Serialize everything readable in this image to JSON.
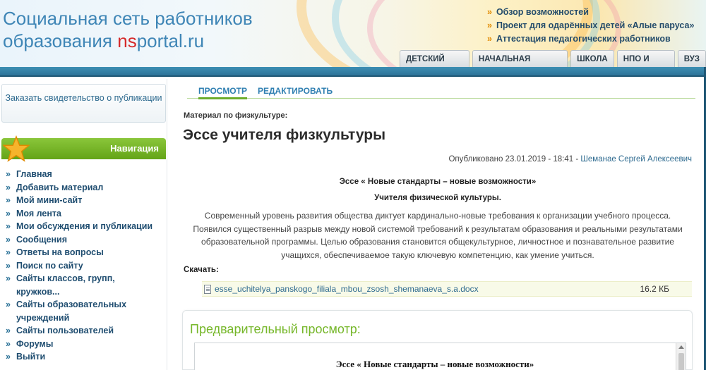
{
  "header": {
    "logo_line1": "Социальная сеть работников",
    "logo_line2_prefix": "образования ",
    "logo_brand_ns": "ns",
    "logo_brand_rest": "portal.ru",
    "top_links": [
      "Обзор возможностей",
      "Проект для одарённых детей «Алые паруса»",
      "Аттестация педагогических работников"
    ],
    "tabs": [
      "ДЕТСКИЙ САД",
      "НАЧАЛЬНАЯ ШКОЛА",
      "ШКОЛА",
      "НПО И СПО",
      "ВУЗ"
    ]
  },
  "sidebar": {
    "cert_button": "Заказать свидетельство о публикации",
    "nav_title": "Навигация",
    "nav_items": [
      "Главная",
      "Добавить материал",
      "Мой мини-сайт",
      "Моя лента",
      "Мои обсуждения и публикации",
      "Сообщения",
      "Ответы на вопросы",
      "Поиск по сайту",
      "Сайты классов, групп, кружков...",
      "Сайты образовательных учреждений",
      "Сайты пользователей",
      "Форумы",
      "Выйти"
    ]
  },
  "main": {
    "view_tab": "ПРОСМОТР",
    "edit_tab": "РЕДАКТИРОВАТЬ",
    "rubric": "Материал по физкультуре:",
    "title": "Эссе учителя физкультуры",
    "published_prefix": "Опубликовано 23.01.2019 - 18:41 - ",
    "author": "Шеманае Сергей Алексеевич",
    "essay_heading": "Эссе « Новые стандарты – новые возможности»",
    "essay_subheading": "Учителя физической культуры.",
    "essay_text": "Современный уровень развития общества диктует кардинально-новые требования к организации учебного процесса. Появился существенный разрыв между новой системой требований к результатам образования и реальными результатами образовательной программы.  Целью образования становится общекультурное, личностное и познавательное развитие учащихся, обеспечиваемое такую ключевую компетенцию, как умение учиться.",
    "download_label": "Скачать:",
    "file_name": "esse_uchitelya_panskogo_filiala_mbou_zsosh_shemanaeva_s.a.docx",
    "file_size": "16.2 КБ",
    "preview_title": "Предварительный просмотр:",
    "preview_doc_heading": "Эссе  « Новые стандарты – новые возможности»"
  }
}
